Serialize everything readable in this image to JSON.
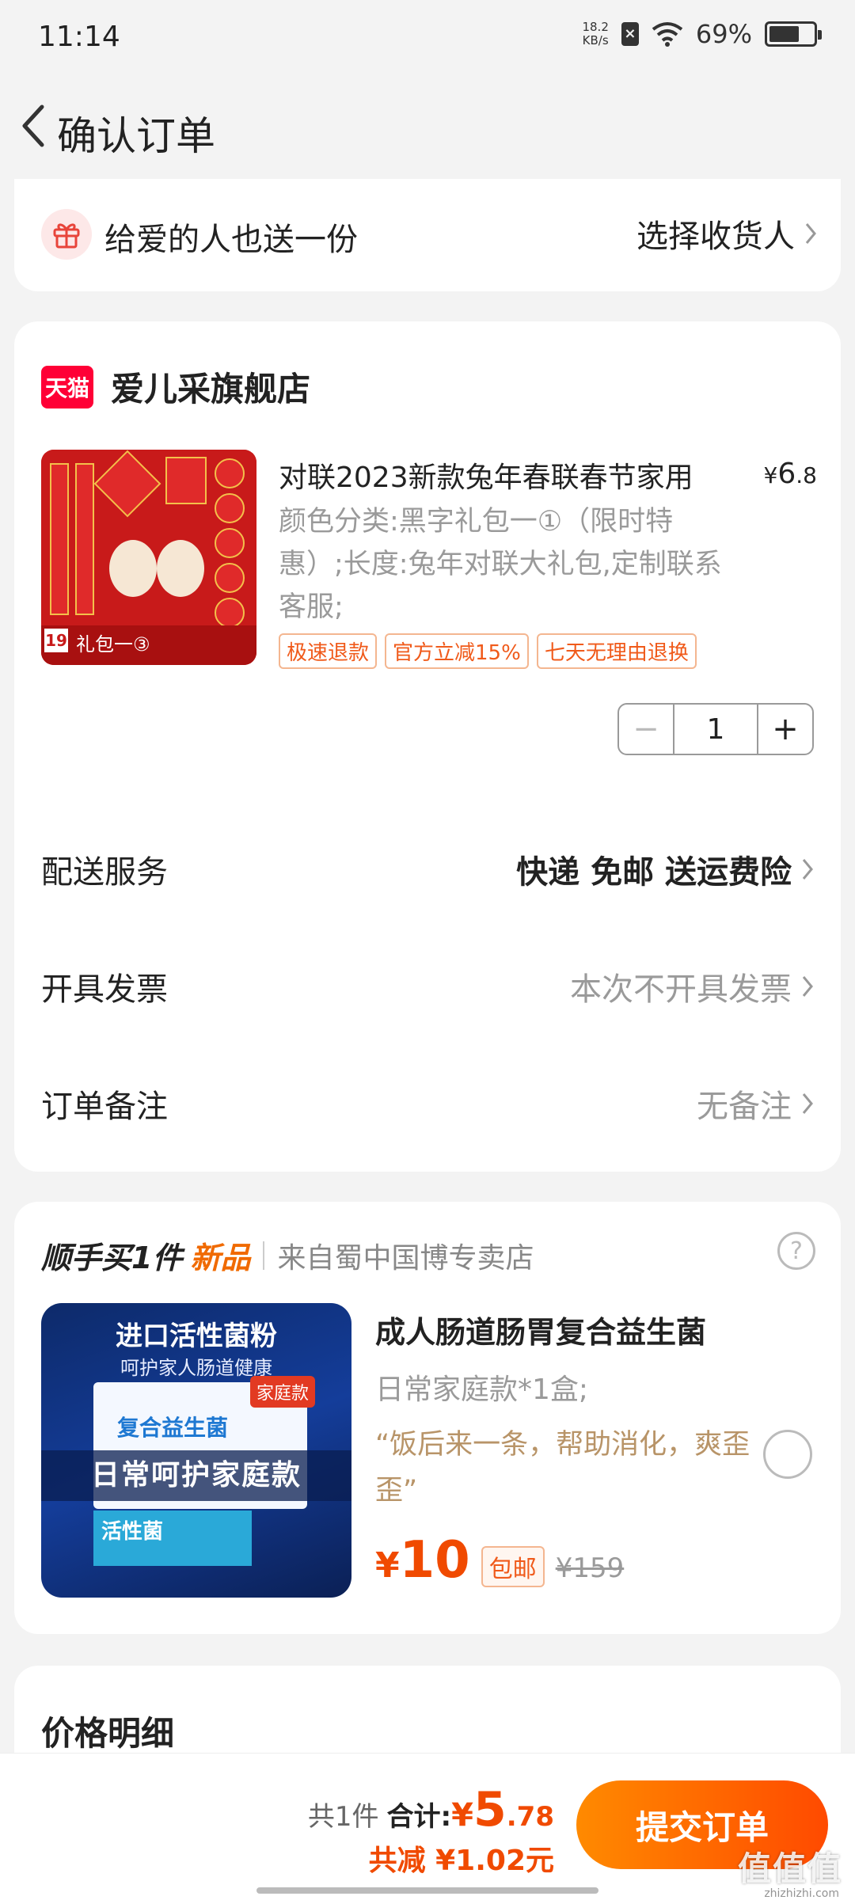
{
  "status_bar": {
    "time": "11:14",
    "net_speed_value": "18.2",
    "net_speed_unit": "KB/s",
    "sim_glyph": "×",
    "battery_percent": "69%",
    "battery_level": 0.69
  },
  "nav": {
    "title": "确认订单"
  },
  "gift": {
    "text": "给爱的人也送一份",
    "action": "选择收货人"
  },
  "shop": {
    "logo_text": "天猫",
    "name": "爱儿采旗舰店"
  },
  "product": {
    "title": "对联2023新款兔年春联春节家用",
    "price_symbol": "¥",
    "price_int": "6",
    "price_dec": ".8",
    "spec": "颜色分类:黑字礼包一①（限时特惠）;长度:兔年对联大礼包,定制联系客服;",
    "tags": [
      "极速退款",
      "官方立减15%",
      "七天无理由退换"
    ],
    "image_caption": "礼包一③",
    "image_badge": "19",
    "quantity": "1"
  },
  "stepper": {
    "minus": "−",
    "plus": "+"
  },
  "rows": {
    "delivery": {
      "label": "配送服务",
      "value": "快递 免邮 送运费险"
    },
    "invoice": {
      "label": "开具发票",
      "value": "本次不开具发票"
    },
    "remark": {
      "label": "订单备注",
      "value": "无备注"
    }
  },
  "upsell": {
    "buy_one": "顺手买1件",
    "new_tag": "新品",
    "from_store": "来自蜀中国博专卖店",
    "help": "?",
    "title": "成人肠道肠胃复合益生菌",
    "spec": "日常家庭款*1盒;",
    "quote": "“饭后来一条，帮助消化，爽歪歪”",
    "price_symbol": "¥",
    "price": "10",
    "free_ship": "包邮",
    "old_price": "¥159",
    "img_headline": "进口活性菌粉",
    "img_subline": "呵护家人肠道健康",
    "img_badge": "家庭款",
    "img_brand": "复合益生菌",
    "img_banner": "日常呵护家庭款",
    "img_product": "活性菌"
  },
  "price_detail": {
    "title": "价格明细"
  },
  "bottom": {
    "count": "共1件",
    "total_label": "合计:",
    "total_symbol": "¥",
    "total_int": "5",
    "total_dec": ".78",
    "discount": "共减 ¥1.02元",
    "submit": "提交订单"
  },
  "watermark": {
    "main": "值值值",
    "sub": "zhizhizhi.com"
  },
  "colors": {
    "accent": "#f04a00",
    "tmall_red": "#ff0036",
    "tag_border": "#f4b690",
    "muted": "#9a9a9a"
  }
}
